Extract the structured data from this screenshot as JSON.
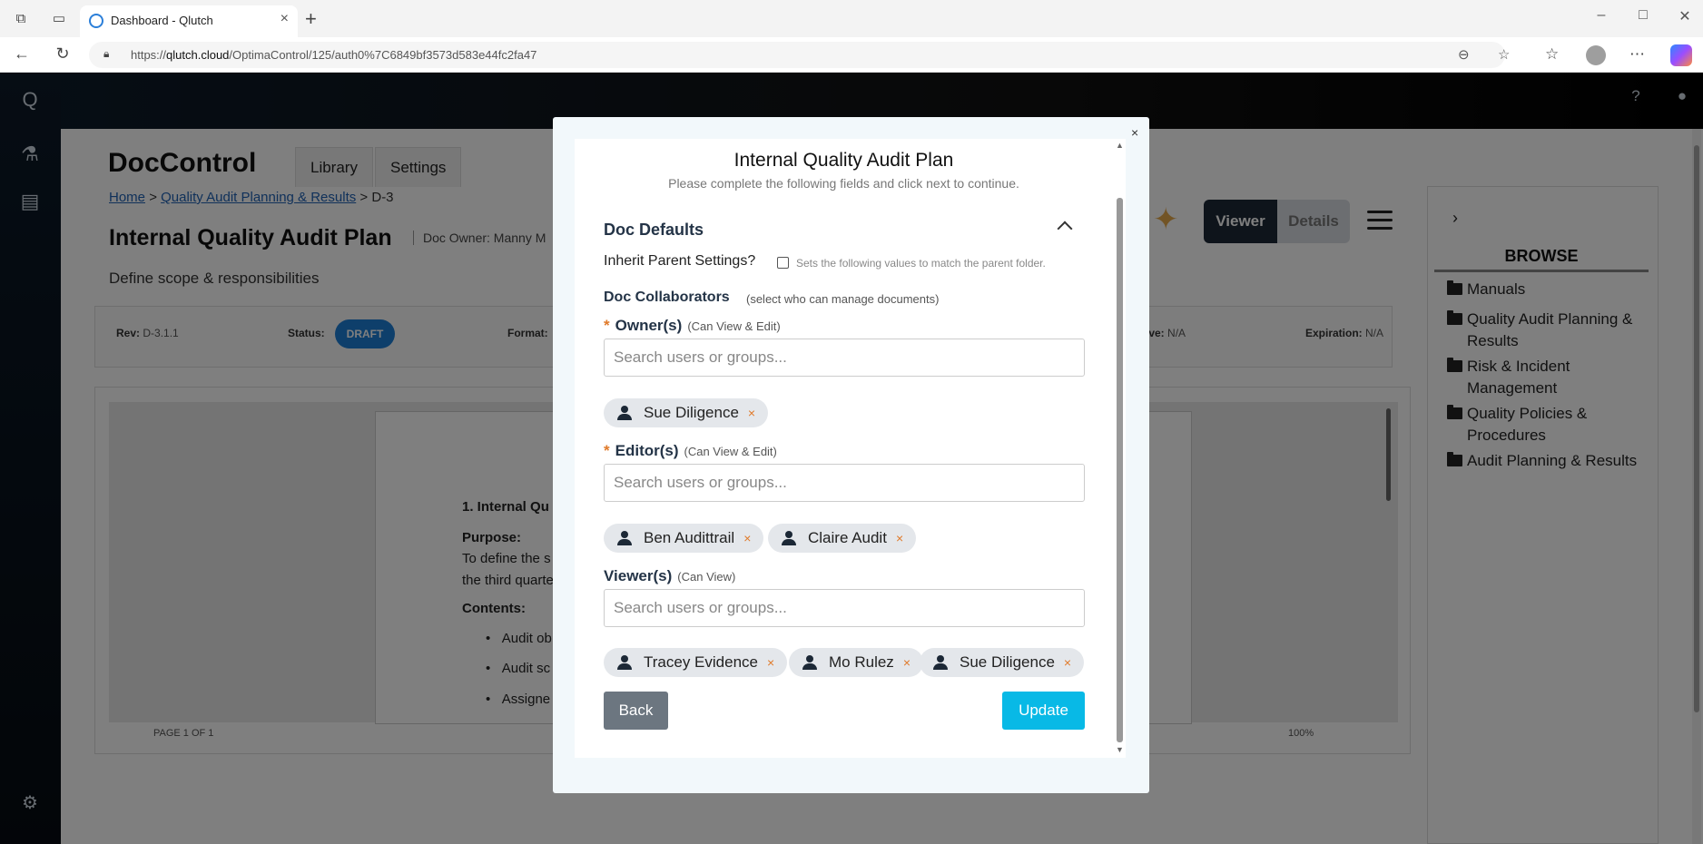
{
  "browser": {
    "tab_title": "Dashboard - Qlutch",
    "url_prefix": "https://",
    "url_host": "qlutch.cloud",
    "url_path": "/OptimaControl/125/auth0%7C6849bf3573d583e44fc2fa47"
  },
  "app": {
    "module_title": "DocControl",
    "tabs": [
      "Library",
      "Settings"
    ],
    "breadcrumb": {
      "home": "Home",
      "folder": "Quality Audit Planning & Results",
      "current": "D-3",
      "sep": ">"
    },
    "doc": {
      "title": "Internal Quality Audit Plan",
      "owner": "Doc Owner: Manny M",
      "description": "Define scope & responsibilities",
      "rev_label": "Rev:",
      "rev_value": "D-3.1.1",
      "status_label": "Status:",
      "status_value": "DRAFT",
      "format_label": "Format:",
      "effective_label": "ive:",
      "effective_value": "N/A",
      "expiration_label": "Expiration:",
      "expiration_value": "N/A"
    },
    "view_toggle": {
      "viewer": "Viewer",
      "details": "Details"
    },
    "preview": {
      "heading": "1. Internal Qu",
      "purpose_label": "Purpose:",
      "purpose_line1": "To define the s",
      "purpose_line2": "the third quarte",
      "contents_label": "Contents:",
      "bullets": [
        "Audit ob",
        "Audit sc",
        "Assigne"
      ],
      "page_info": "PAGE 1 OF 1",
      "zoom": "100%"
    },
    "browse": {
      "title": "BROWSE",
      "folders": [
        "Manuals",
        "Quality Audit Planning & Results",
        "Risk & Incident Management",
        "Quality Policies & Procedures",
        "Audit Planning & Results"
      ]
    }
  },
  "modal": {
    "close": "×",
    "title": "Internal Quality Audit Plan",
    "subtitle": "Please complete the following fields and click next to continue.",
    "section_title": "Doc Defaults",
    "inherit_label": "Inherit Parent Settings?",
    "inherit_hint": "Sets the following values to match the parent folder.",
    "inherit_checked": false,
    "collaborators_label": "Doc Collaborators",
    "collaborators_hint": "(select who can manage documents)",
    "required_mark": "*",
    "owners": {
      "label": "Owner(s)",
      "perm": "(Can View & Edit)",
      "placeholder": "Search users or groups...",
      "chips": [
        "Sue Diligence"
      ]
    },
    "editors": {
      "label": "Editor(s)",
      "perm": "(Can View & Edit)",
      "placeholder": "Search users or groups...",
      "chips": [
        "Ben Audittrail",
        "Claire Audit"
      ]
    },
    "viewers": {
      "label": "Viewer(s)",
      "perm": "(Can View)",
      "placeholder": "Search users or groups...",
      "chips": [
        "Tracey Evidence",
        "Mo Rulez",
        "Sue Diligence"
      ]
    },
    "chip_remove": "×",
    "back_label": "Back",
    "update_label": "Update"
  },
  "colors": {
    "accent": "#08b9e6",
    "draft": "#1d7fd6",
    "required": "#e07a2a",
    "dark": "#1c2836"
  }
}
